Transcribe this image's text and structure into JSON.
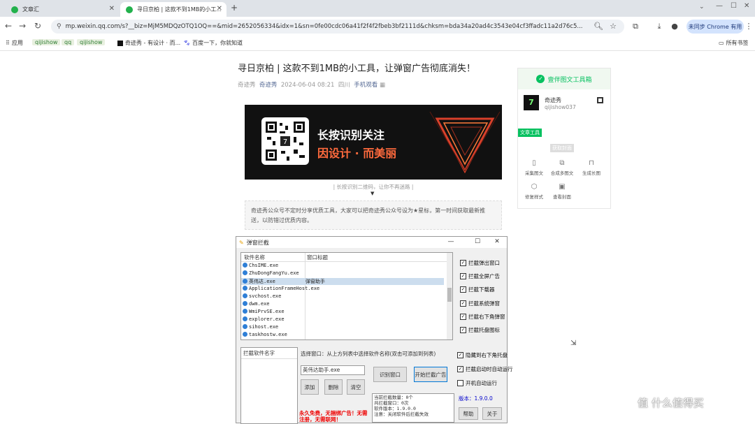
{
  "browser": {
    "tabs": [
      {
        "title": "文章汇",
        "active": false
      },
      {
        "title": "寻日京柏 | 这款不到1MB的小工...",
        "active": true
      }
    ],
    "address": "mp.weixin.qq.com/s?__biz=MjM5MDQzOTQ1OQ==&mid=2652056334&idx=1&sn=0fe00cdc06a41f2f4f2fbeb3bf2111d&chksm=bda34a20ad4c3543e04cf3ffadc11a2d76c5...",
    "sync_label": "未同步 Chrome 有用",
    "bookmarks": [
      "应用",
      "qijishow",
      "qq",
      "qijishow",
      "奇迹秀 - 有设计 · 而...",
      "百度一下，你就知道"
    ],
    "all_bookmarks": "所有书签",
    "accent": "#07c160"
  },
  "article": {
    "title": "寻日京柏 | 这款不到1MB的小工具，让弹窗广告彻底消失！",
    "meta_source": "奇迹秀",
    "meta_author": "奇迹秀",
    "meta_date": "2024-06-04 08:21",
    "meta_loc": "四川",
    "meta_link": "手机观看",
    "banner_line1": "长按识别关注",
    "banner_line2": "因设计 · 而美丽",
    "caption": "| 长按识别二维码，让你不再迷路 |",
    "arrow": "▼",
    "intro": "奇迹秀公众号不定时分享优质工具，大家可以把奇迹秀公众号设为★星标，第一时间获取最新推送，以防错过优质内容。"
  },
  "panel": {
    "header": "壹伴图文工具箱",
    "name": "奇迹秀",
    "id": "qijishow037",
    "tag_green": "文章工具",
    "tag_gray": "获取封面",
    "tools": [
      "采集图文",
      "合成多图文",
      "生成长图",
      "修复样式",
      "查看封面"
    ]
  },
  "dialog": {
    "title": "弹窗拦截",
    "col1": "软件名称",
    "col2": "窗口标题",
    "processes": [
      {
        "name": "ChsIME.exe",
        "title": ""
      },
      {
        "name": "ZhuDongFangYu.exe",
        "title": ""
      },
      {
        "name": "英伟达.exe",
        "title": "弹窗助手"
      },
      {
        "name": "ApplicationFrameHost.exe",
        "title": ""
      },
      {
        "name": "svchost.exe",
        "title": ""
      },
      {
        "name": "dwm.exe",
        "title": ""
      },
      {
        "name": "WmiPrvSE.exe",
        "title": ""
      },
      {
        "name": "explorer.exe",
        "title": ""
      },
      {
        "name": "sihost.exe",
        "title": ""
      },
      {
        "name": "taskhostw.exe",
        "title": ""
      }
    ],
    "right_checks": [
      "拦截弹出窗口",
      "拦截全屏广告",
      "拦截下载器",
      "拦截系统弹窗",
      "拦截右下角弹窗",
      "拦截托盘图标"
    ],
    "list_header": "拦截软件名字",
    "hint": "选择窗口：从上方列表中选择软件名称(双击可添加到列表)",
    "input_value": "英伟达助手.exe",
    "btn_add": "添加",
    "btn_delete": "删除",
    "btn_clear": "清空",
    "btn_find": "识别窗口",
    "btn_start": "开始拦截广告",
    "bottom_checks": [
      {
        "label": "隐藏到右下角托盘",
        "checked": true
      },
      {
        "label": "拦截启动时自动运行",
        "checked": true
      },
      {
        "label": "开机自动运行",
        "checked": false
      }
    ],
    "red_text": "永久免费，无捆绑广告！无需注册，无需联网！",
    "info": "当前拦截数量：0个\n共拦截窗口：0次\n软件版本：1.9.0.0\n注意：关闭软件后拦截失效",
    "version": "版本：1.9.0.0",
    "btn_help": "帮助",
    "btn_about": "关于"
  },
  "logo": "值 什么值得买"
}
